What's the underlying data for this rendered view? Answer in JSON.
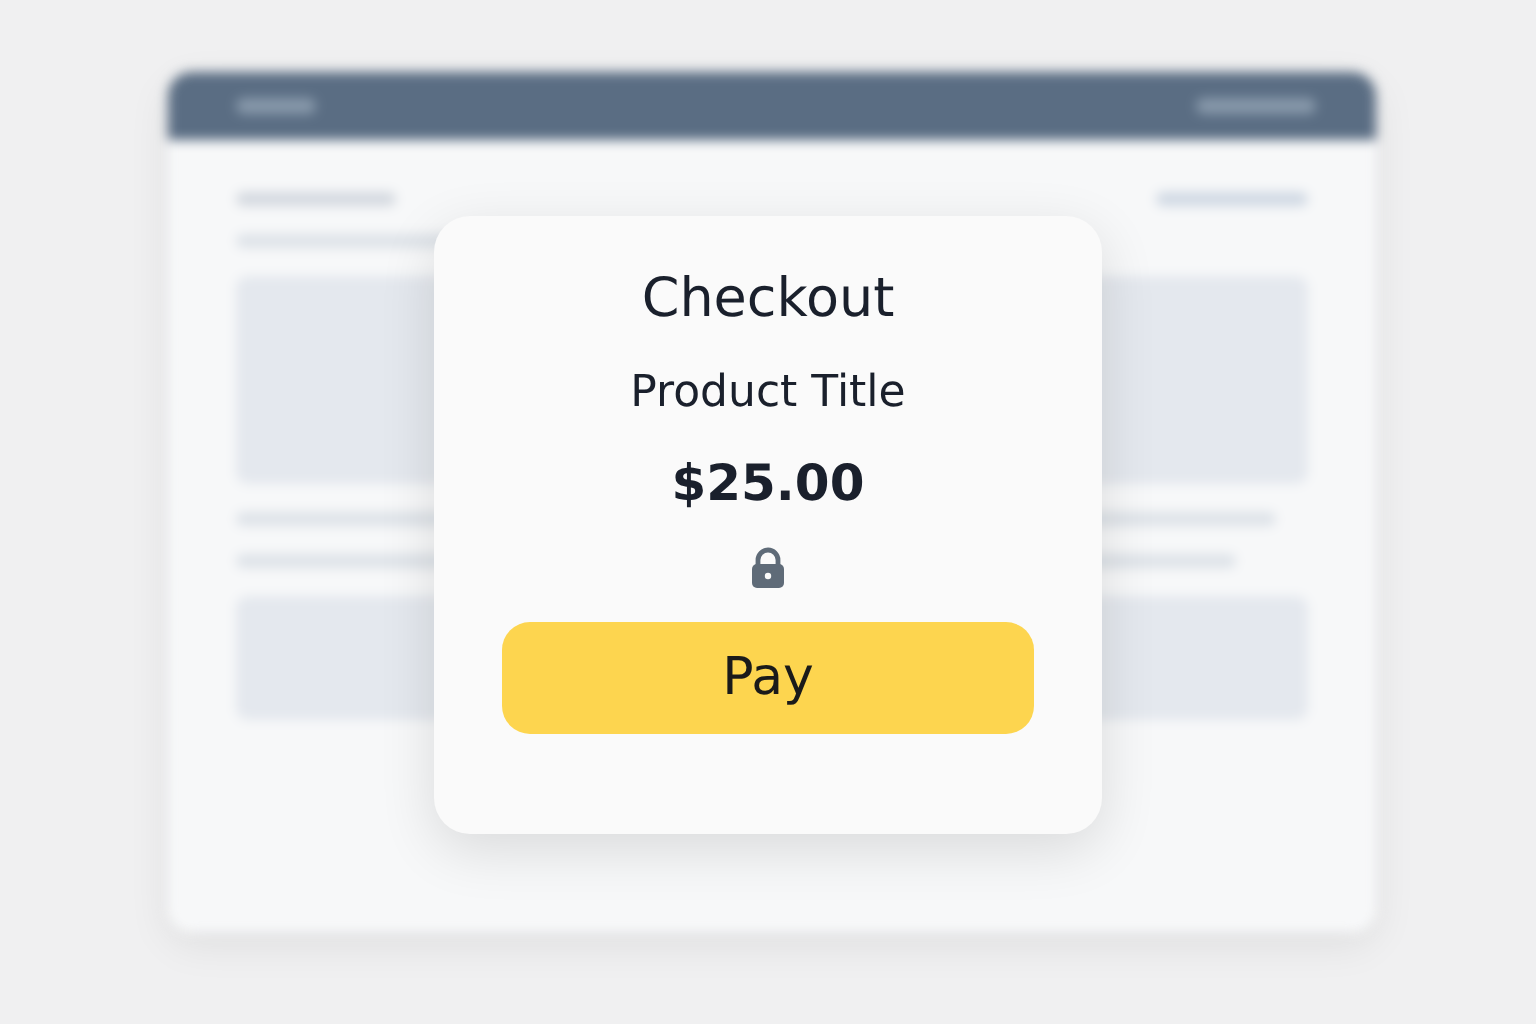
{
  "dialog": {
    "title": "Checkout",
    "product": "Product Title",
    "price": "$25.00",
    "button": "Pay"
  }
}
